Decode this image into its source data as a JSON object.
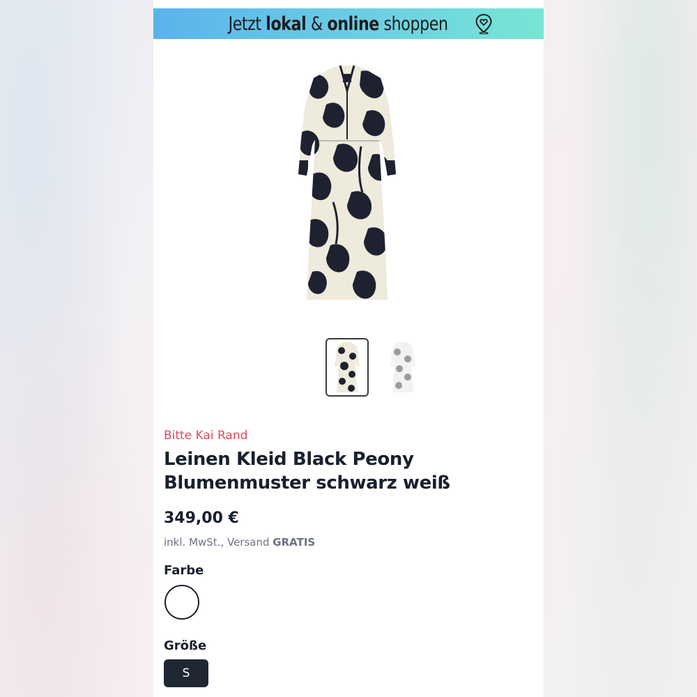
{
  "promo": {
    "prefix": "Jetzt",
    "bold1": "lokal",
    "amp": "&",
    "bold2": "online",
    "suffix": "shoppen",
    "icon": "location-heart-icon"
  },
  "product": {
    "brand": "Bitte Kai Rand",
    "title_line1": "Leinen Kleid Black Peony",
    "title_line2": "Blumenmuster schwarz weiß",
    "price": "349,00 €",
    "tax_prefix": "inkl. MwSt., Versand",
    "tax_bold": "GRATIS",
    "image_count": 2,
    "selected_image": 1
  },
  "options": {
    "color_label": "Farbe",
    "color_selected": "#ffffff",
    "size_label": "Größe",
    "size_selected": "S"
  },
  "colors": {
    "brand_text": "#e2475d",
    "dress_dark": "#1e2130",
    "dress_light": "#eeeadc",
    "chip_bg": "#1f2733"
  }
}
